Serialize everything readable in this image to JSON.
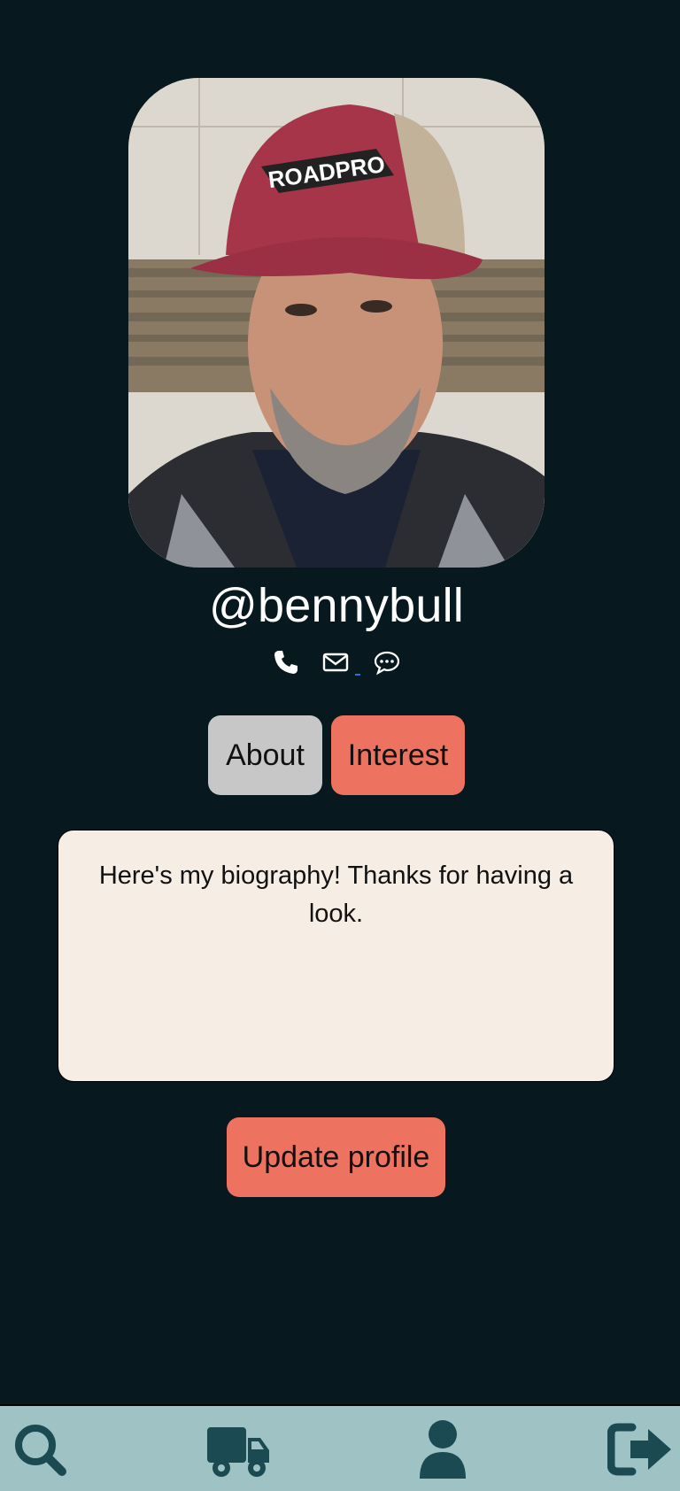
{
  "profile": {
    "photo_alt": "profile photo",
    "username": "@bennybull",
    "cap_text": "ROADPRO"
  },
  "contact": {
    "icons": [
      "phone-icon",
      "envelope-icon",
      "chat-bubble-icon"
    ]
  },
  "tabs": {
    "about_label": "About",
    "interest_label": "Interest"
  },
  "bio": {
    "text": "Here's my biography! Thanks for having a look."
  },
  "actions": {
    "update_label": "Update profile"
  },
  "bottom_nav": {
    "items": [
      "search-icon",
      "truck-icon",
      "user-icon",
      "logout-icon"
    ]
  },
  "colors": {
    "background": "#07191e",
    "accent": "#ee7260",
    "tab_inactive": "#c7c7c7",
    "bio_background": "#f6ede4",
    "nav_background": "#9fc3c5",
    "nav_icon": "#1b4a52"
  }
}
